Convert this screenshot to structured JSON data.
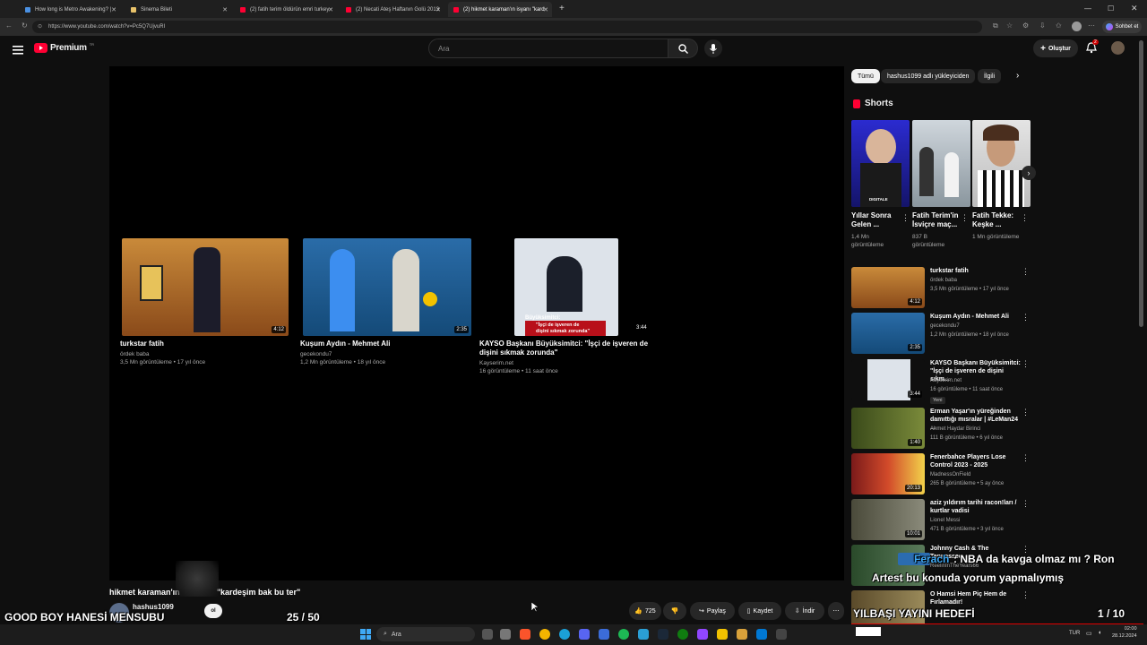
{
  "browser": {
    "tabs": [
      {
        "title": "How long is Metro Awakening? | ",
        "color": "#4a90e2"
      },
      {
        "title": "Sinema Bileti",
        "color": "#e8c26a"
      },
      {
        "title": "(2) fatih terim öldürün emri turkey",
        "color": "#ff0033"
      },
      {
        "title": "(2) Necati Ateş Haftanın Golü 2013",
        "color": "#ff0033"
      },
      {
        "title": "(2) hikmet karaman'ın isyanı \"kard",
        "color": "#ff0033"
      }
    ],
    "url": "https://www.youtube.com/watch?v=Pc5Q7UjvuRI",
    "copilot": "Sohbet et"
  },
  "header": {
    "logo": "Premium",
    "logo_badge": "TR",
    "search_placeholder": "Ara",
    "create_label": "Oluştur",
    "notif_count": "2"
  },
  "endscreen": [
    {
      "title": "turkstar fatih",
      "channel": "ördek baba",
      "meta": "3,5 Mn görüntüleme • 17 yıl önce",
      "duration": "4:12"
    },
    {
      "title": "Kuşum Aydın - Mehmet Ali",
      "channel": "gecekondu7",
      "meta": "1,2 Mn görüntüleme • 18 yıl önce",
      "duration": "2:35"
    },
    {
      "title": "KAYSO Başkanı Büyüksimitci: \"İşçi de işveren de dişini sıkmak zorunda\"",
      "channel": "Kayserim.net",
      "meta": "16 görüntüleme • 11 saat önce",
      "duration": "3:44",
      "caption1": "Büyüksimitci:",
      "caption2": "\"İşçi de işveren de",
      "caption3": "dişini sıkmak zorunda\""
    }
  ],
  "video": {
    "title_left": "hikmet karaman'ın",
    "title_right": "\"kardeşim bak bu ter\"",
    "channel": "hashus1099",
    "subscribe_fragment": "ol",
    "likes": "725",
    "share": "Paylaş",
    "save": "Kaydet",
    "download": "İndir"
  },
  "sidebar": {
    "chips": [
      "Tümü",
      "hashus1099 adlı yükleyiciden",
      "İlgili"
    ],
    "shorts_heading": "Shorts",
    "shorts": [
      {
        "title": "Yıllar Sonra Gelen ...",
        "views": "1,4 Mn görüntüleme",
        "thumb_text": "DIGITALE"
      },
      {
        "title": "Fatih Terim'in İsviçre maç...",
        "views": "837 B görüntüleme"
      },
      {
        "title": "Fatih Tekke: Keşke ...",
        "views": "1 Mn görüntüleme"
      }
    ],
    "recs": [
      {
        "title": "turkstar fatih",
        "channel": "ördek baba",
        "meta": "3,5 Mn görüntüleme • 17 yıl önce",
        "duration": "4:12"
      },
      {
        "title": "Kuşum Aydın - Mehmet Ali",
        "channel": "gecekondu7",
        "meta": "1,2 Mn görüntüleme • 18 yıl önce",
        "duration": "2:35"
      },
      {
        "title": "KAYSO Başkanı Büyüksimitci: \"İşçi de işveren de dişini sıkm...",
        "channel": "Kayserim.net",
        "meta": "16 görüntüleme • 11 saat önce",
        "duration": "3:44",
        "badge": "Yeni"
      },
      {
        "title": "Erman Yaşar'ın yüreğinden damıttığı mısralar | #LeMan24 ...",
        "channel": "Ahmet Haydar Birinci",
        "meta": "111 B görüntüleme • 6 yıl önce",
        "duration": "1:40"
      },
      {
        "title": "Fenerbahce Players Lose Control 2023 - 2025",
        "channel": "MadnessOnField",
        "meta": "265 B görüntüleme • 5 ay önce",
        "duration": "20:13"
      },
      {
        "title": "aziz yıldırım tarihi racon!ları / kurtlar vadisi",
        "channel": "Lionel Messi",
        "meta": "471 B görüntüleme • 3 yıl önce",
        "duration": "10:01"
      },
      {
        "title": "Johnny Cash & The Tennessee",
        "channel": "ReelinInTheYears66",
        "meta": ""
      },
      {
        "title": "O Hamsi Hem Piç Hem de Fırlamadır!",
        "channel": "",
        "meta": ""
      }
    ]
  },
  "overlays": {
    "goal_left_label": "GOOD BOY HANESİ MENSUBU",
    "goal_left_count": "25  / 50",
    "chat_name": "Ferach",
    "chat_message_1": ": NBA da kavga olmaz mı ? Ron",
    "chat_message_2": "Artest bu konuda yorum yapmalıymış",
    "goal_right_label": "YILBAŞI YAYINI HEDEFİ",
    "goal_right_count": "1 / 10"
  },
  "taskbar": {
    "search_label": "Ara",
    "lang": "TUR",
    "time": "02:00",
    "date": "28.12.2024"
  }
}
